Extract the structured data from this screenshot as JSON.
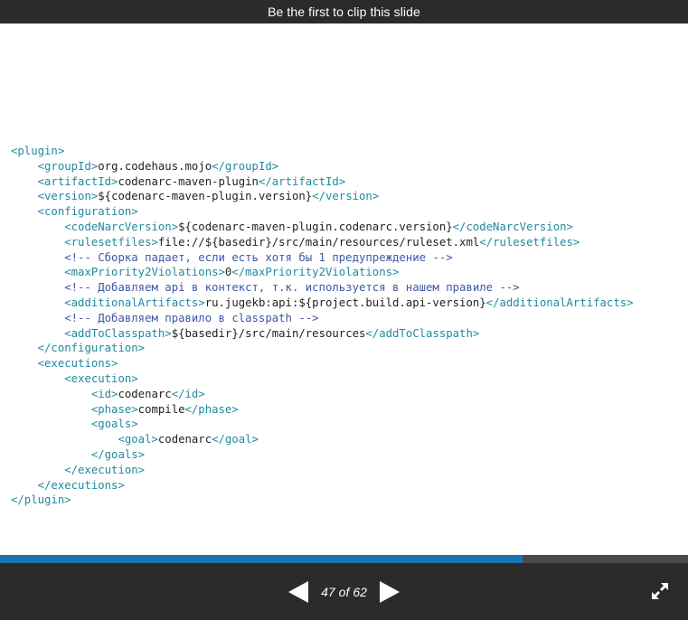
{
  "banner": {
    "text": "Be the first to clip this slide"
  },
  "code_lines": [
    {
      "indent": 0,
      "parts": [
        {
          "t": "tag",
          "v": "<plugin>"
        }
      ]
    },
    {
      "indent": 1,
      "parts": [
        {
          "t": "tag",
          "v": "<groupId>"
        },
        {
          "t": "txt",
          "v": "org.codehaus.mojo"
        },
        {
          "t": "tag",
          "v": "</groupId>"
        }
      ]
    },
    {
      "indent": 1,
      "parts": [
        {
          "t": "tag",
          "v": "<artifactId>"
        },
        {
          "t": "txt",
          "v": "codenarc-maven-plugin"
        },
        {
          "t": "tag",
          "v": "</artifactId>"
        }
      ]
    },
    {
      "indent": 1,
      "parts": [
        {
          "t": "tag",
          "v": "<version>"
        },
        {
          "t": "txt",
          "v": "${codenarc-maven-plugin.version}"
        },
        {
          "t": "tag",
          "v": "</version>"
        }
      ]
    },
    {
      "indent": 1,
      "parts": [
        {
          "t": "tag",
          "v": "<configuration>"
        }
      ]
    },
    {
      "indent": 2,
      "parts": [
        {
          "t": "tag",
          "v": "<codeNarcVersion>"
        },
        {
          "t": "txt",
          "v": "${codenarc-maven-plugin.codenarc.version}"
        },
        {
          "t": "tag",
          "v": "</codeNarcVersion>"
        }
      ]
    },
    {
      "indent": 2,
      "parts": [
        {
          "t": "tag",
          "v": "<rulesetfiles>"
        },
        {
          "t": "txt",
          "v": "file://${basedir}/src/main/resources/ruleset.xml"
        },
        {
          "t": "tag",
          "v": "</rulesetfiles>"
        }
      ]
    },
    {
      "indent": 2,
      "parts": [
        {
          "t": "cmt",
          "v": "<!-- Сборка падает, если есть хотя бы 1 предупреждение -->"
        }
      ]
    },
    {
      "indent": 2,
      "parts": [
        {
          "t": "tag",
          "v": "<maxPriority2Violations>"
        },
        {
          "t": "txt",
          "v": "0"
        },
        {
          "t": "tag",
          "v": "</maxPriority2Violations>"
        }
      ]
    },
    {
      "indent": 2,
      "parts": [
        {
          "t": "cmt",
          "v": "<!-- Добавляем api в контекст, т.к. используется в нашем правиле -->"
        }
      ]
    },
    {
      "indent": 2,
      "parts": [
        {
          "t": "tag",
          "v": "<additionalArtifacts>"
        },
        {
          "t": "txt",
          "v": "ru.jugekb:api:${project.build.api-version}"
        },
        {
          "t": "tag",
          "v": "</additionalArtifacts>"
        }
      ]
    },
    {
      "indent": 2,
      "parts": [
        {
          "t": "cmt",
          "v": "<!-- Добавляем правило в classpath -->"
        }
      ]
    },
    {
      "indent": 2,
      "parts": [
        {
          "t": "tag",
          "v": "<addToClasspath>"
        },
        {
          "t": "txt",
          "v": "${basedir}/src/main/resources"
        },
        {
          "t": "tag",
          "v": "</addToClasspath>"
        }
      ]
    },
    {
      "indent": 1,
      "parts": [
        {
          "t": "tag",
          "v": "</configuration>"
        }
      ]
    },
    {
      "indent": 1,
      "parts": [
        {
          "t": "tag",
          "v": "<executions>"
        }
      ]
    },
    {
      "indent": 2,
      "parts": [
        {
          "t": "tag",
          "v": "<execution>"
        }
      ]
    },
    {
      "indent": 3,
      "parts": [
        {
          "t": "tag",
          "v": "<id>"
        },
        {
          "t": "txt",
          "v": "codenarc"
        },
        {
          "t": "tag",
          "v": "</id>"
        }
      ]
    },
    {
      "indent": 3,
      "parts": [
        {
          "t": "tag",
          "v": "<phase>"
        },
        {
          "t": "txt",
          "v": "compile"
        },
        {
          "t": "tag",
          "v": "</phase>"
        }
      ]
    },
    {
      "indent": 3,
      "parts": [
        {
          "t": "tag",
          "v": "<goals>"
        }
      ]
    },
    {
      "indent": 4,
      "parts": [
        {
          "t": "tag",
          "v": "<goal>"
        },
        {
          "t": "txt",
          "v": "codenarc"
        },
        {
          "t": "tag",
          "v": "</goal>"
        }
      ]
    },
    {
      "indent": 3,
      "parts": [
        {
          "t": "tag",
          "v": "</goals>"
        }
      ]
    },
    {
      "indent": 2,
      "parts": [
        {
          "t": "tag",
          "v": "</execution>"
        }
      ]
    },
    {
      "indent": 1,
      "parts": [
        {
          "t": "tag",
          "v": "</executions>"
        }
      ]
    },
    {
      "indent": 0,
      "parts": [
        {
          "t": "tag",
          "v": "</plugin>"
        }
      ]
    }
  ],
  "navigation": {
    "current": "47",
    "separator": "of",
    "total": "62",
    "progress_fraction": 0.76,
    "prev_icon": "triangle-left-icon",
    "next_icon": "triangle-right-icon",
    "fullscreen_icon": "expand-icon"
  },
  "colors": {
    "tag": "#1f8aa0",
    "text": "#222222",
    "comment": "#3f56a8",
    "bar": "#2b2b2b",
    "progress": "#1a73b0"
  }
}
